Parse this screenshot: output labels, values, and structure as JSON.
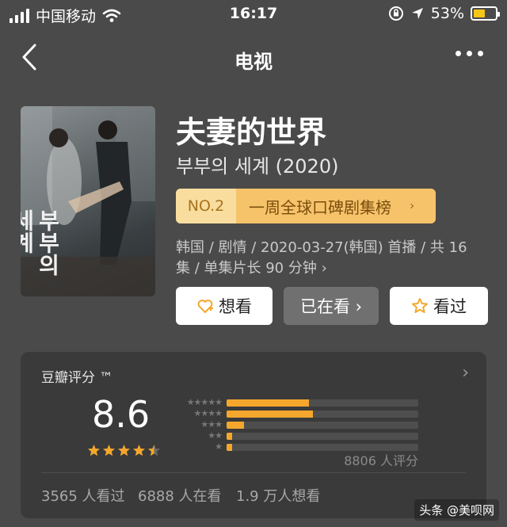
{
  "status_bar": {
    "carrier": "中国移动",
    "time": "16:17",
    "battery_percent": "53%",
    "battery_level": 0.53,
    "icons": [
      "signal-icon",
      "wifi-icon",
      "orientation-lock-icon",
      "location-icon",
      "battery-icon"
    ]
  },
  "nav": {
    "title": "电视",
    "back_icon": "back-chevron-icon",
    "more_icon": "more-dots-icon"
  },
  "poster": {
    "vertical_title": "부부의세계"
  },
  "show": {
    "title": "夫妻的世界",
    "original_title": "부부의 세계 (2020)",
    "rank_no": "NO.2",
    "rank_text": "一周全球口碑剧集榜",
    "meta_line1": "韩国 / 剧情 / 2020-03-27(韩国) 首播 / 共 16",
    "meta_line2": "集 / 单集片长 90 分钟 ›"
  },
  "actions": {
    "want_label": "想看",
    "watching_label": "已在看 ›",
    "watched_label": "看过"
  },
  "rating": {
    "label": "豆瓣评分 ™",
    "score": "8.6",
    "stars_value": 4.5,
    "count_text": "8806 人评分",
    "distribution": [
      {
        "stars": 5,
        "fraction": 0.43
      },
      {
        "stars": 4,
        "fraction": 0.45
      },
      {
        "stars": 3,
        "fraction": 0.09
      },
      {
        "stars": 2,
        "fraction": 0.03
      },
      {
        "stars": 1,
        "fraction": 0.03
      }
    ],
    "watched_text": "3565 人看过",
    "watching_text": "6888 人在看",
    "want_text": "1.9 万人想看"
  },
  "watermark": "头条 @美呗网",
  "colors": {
    "background": "#4a4a4a",
    "card": "#3a3a3a",
    "accent_orange": "#f4a72c",
    "rank_badge": "#f6c36b"
  }
}
